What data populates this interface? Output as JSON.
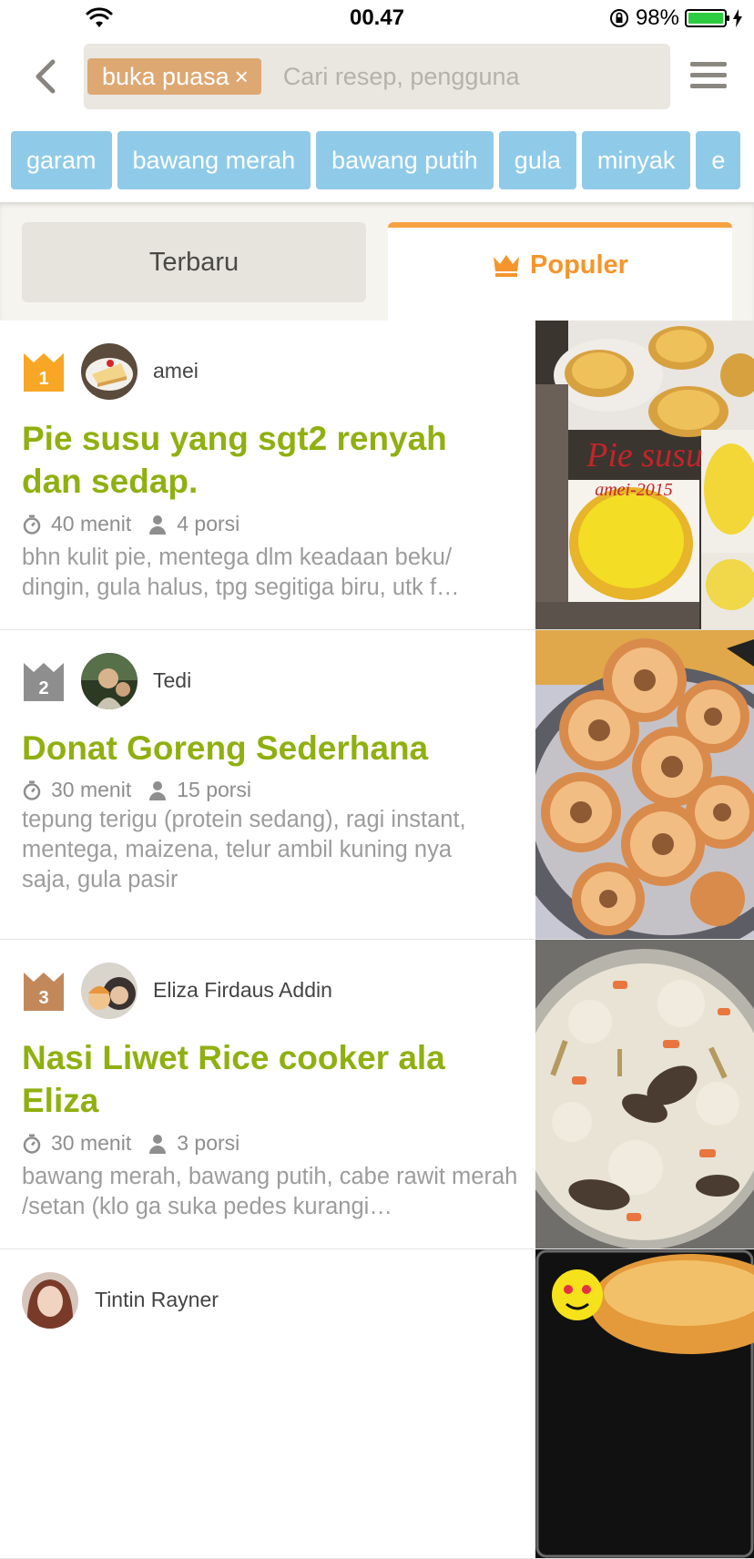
{
  "status": {
    "time": "00.47",
    "battery": "98%"
  },
  "search": {
    "chip": "buka puasa",
    "chip_close": "×",
    "placeholder": "Cari resep, pengguna"
  },
  "ingredients": [
    "garam",
    "bawang merah",
    "bawang putih",
    "gula",
    "minyak",
    "e"
  ],
  "tabs": {
    "latest": "Terbaru",
    "popular": "Populer"
  },
  "recipes": [
    {
      "rank": "1",
      "author": "amei",
      "title": "Pie susu yang sgt2 renyah dan sedap.",
      "time": "40 menit",
      "servings": "4 porsi",
      "ingredients": "bhn kulit pie, mentega dlm keadaan beku/ dingin, gula halus, tpg segitiga biru, utk f…",
      "photo_text": "Pie susu",
      "photo_subtext": "amei-2015"
    },
    {
      "rank": "2",
      "author": "Tedi",
      "title": "Donat Goreng Sederhana",
      "time": "30 menit",
      "servings": "15 porsi",
      "ingredients": "tepung terigu (protein sedang), ragi instant, mentega, maizena, telur ambil kuning nya saja, gula pasir"
    },
    {
      "rank": "3",
      "author": "Eliza Firdaus Addin",
      "title": "Nasi Liwet Rice cooker ala Eliza",
      "time": "30 menit",
      "servings": "3 porsi",
      "ingredients": "bawang merah, bawang putih, cabe rawit merah /setan (klo ga suka pedes kurangi…"
    },
    {
      "author": "Tintin Rayner"
    }
  ],
  "colors": {
    "accent": "#8fb010",
    "popular": "#f5952b",
    "chip": "#dea873",
    "ingredient": "#8fcbe8",
    "rank1": "#f7a626",
    "rank2": "#8e8e8e",
    "rank3": "#c2885a"
  }
}
